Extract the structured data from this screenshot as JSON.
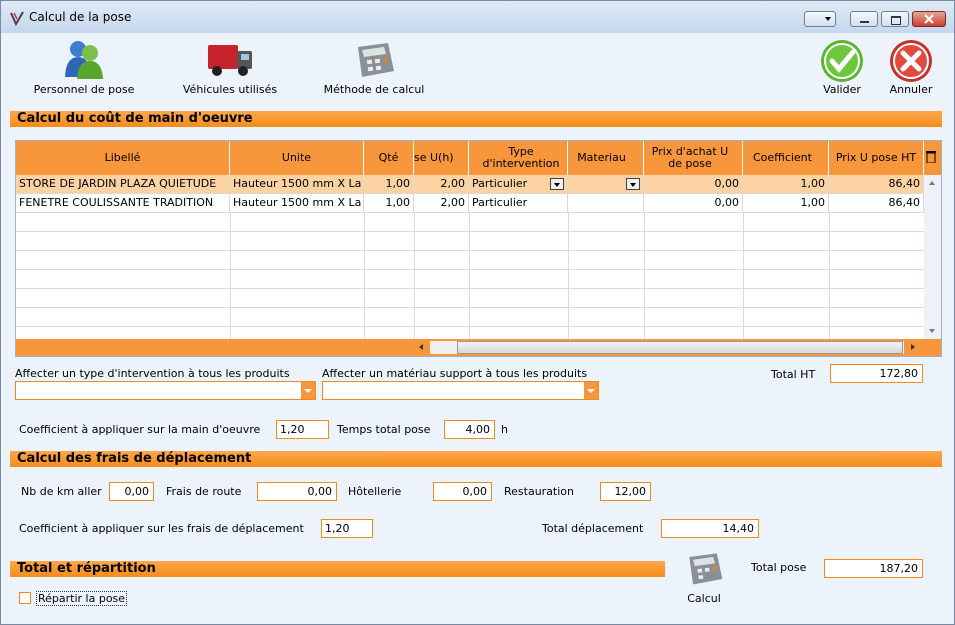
{
  "window": {
    "title": "Calcul de la pose"
  },
  "toolbar": {
    "personnel": "Personnel de pose",
    "vehicules": "Véhicules utilisés",
    "methode": "Méthode de calcul",
    "valider": "Valider",
    "annuler": "Annuler"
  },
  "sections": {
    "main_oeuvre": "Calcul du coût de main d'oeuvre",
    "deplacement": "Calcul des frais de déplacement",
    "total": "Total et répartition"
  },
  "grid": {
    "columns": [
      "Libellé",
      "Unite",
      "Qté",
      "se U(h)",
      "Type d'intervention",
      "Materiau",
      "Prix d'achat U de pose",
      "Coefficient",
      "Prix U pose HT"
    ],
    "rows": [
      {
        "libelle": "STORE DE JARDIN PLAZA QUIETUDE",
        "unite": "Hauteur 1500 mm X La",
        "qte": "1,00",
        "temps": "2,00",
        "type": "Particulier",
        "materiau": "",
        "prix_achat": "0,00",
        "coef": "1,00",
        "prix_u": "86,40"
      },
      {
        "libelle": "FENETRE COULISSANTE TRADITION",
        "unite": "Hauteur 1500 mm X La",
        "qte": "1,00",
        "temps": "2,00",
        "type": "Particulier",
        "materiau": "",
        "prix_achat": "0,00",
        "coef": "1,00",
        "prix_u": "86,40"
      }
    ]
  },
  "form": {
    "affecter_type_label": "Affecter un type d'intervention à tous les produits",
    "affecter_mat_label": "Affecter un matériau support à tous les produits",
    "total_ht_label": "Total HT",
    "total_ht": "172,80",
    "coef_mo_label": "Coefficient à appliquer sur la main d'oeuvre",
    "coef_mo": "1,20",
    "temps_total_label": "Temps total pose",
    "temps_total": "4,00",
    "temps_unit": "h",
    "km_label": "Nb de km aller",
    "km": "0,00",
    "route_label": "Frais de route",
    "route": "0,00",
    "hotel_label": "Hôtellerie",
    "hotel": "0,00",
    "resto_label": "Restauration",
    "resto": "12,00",
    "coef_dep_label": "Coefficient à appliquer sur les frais de déplacement",
    "coef_dep": "1,20",
    "total_dep_label": "Total déplacement",
    "total_dep": "14,40",
    "total_pose_label": "Total pose",
    "total_pose": "187,20",
    "calcul_label": "Calcul",
    "repartir_label": "Répartir la pose"
  },
  "colors": {
    "accent": "#f7963b",
    "selected_row": "#fbd2a2",
    "valider": "#5cb531",
    "annuler": "#d9352b"
  }
}
